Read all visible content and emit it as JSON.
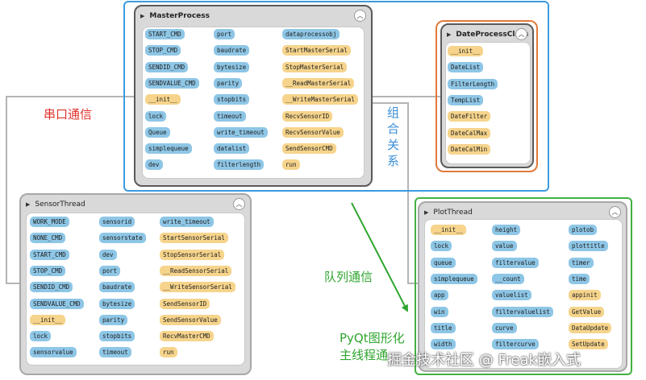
{
  "colors": {
    "attribute_chip": "#8ec6e6",
    "method_chip": "#f6d48c",
    "master_frame": "#3a9be0",
    "date_frame": "#e07a3a",
    "plot_frame": "#43b043",
    "serial_label": "#e0312b",
    "compose_label": "#3a8fd6",
    "queue_label": "#2fa52f",
    "connector": "#b5b5b5",
    "arrow": "#2fa52f"
  },
  "icons": {
    "collapse": "chevron-up-icon",
    "expand": "disclosure-triangle-icon"
  },
  "labels": {
    "serial_comm": "串口通信",
    "composition": "组合关系",
    "queue_comm": "队列通信",
    "pyqt_line1": "PyQt图形化",
    "pyqt_line2": "主线程通",
    "watermark": "掘金技术社区 @ Freak嵌入式"
  },
  "classes": {
    "master": {
      "title": "MasterProcess",
      "columns": [
        [
          {
            "t": "START_CMD",
            "k": "attr"
          },
          {
            "t": "STOP_CMD",
            "k": "attr"
          },
          {
            "t": "SENDID_CMD",
            "k": "attr"
          },
          {
            "t": "SENDVALUE_CMD",
            "k": "attr"
          },
          {
            "t": "__init__",
            "k": "meth"
          },
          {
            "t": "lock",
            "k": "attr"
          },
          {
            "t": "Queue",
            "k": "attr"
          },
          {
            "t": "simplequeue",
            "k": "attr"
          },
          {
            "t": "dev",
            "k": "attr"
          }
        ],
        [
          {
            "t": "port",
            "k": "attr"
          },
          {
            "t": "baudrate",
            "k": "attr"
          },
          {
            "t": "bytesize",
            "k": "attr"
          },
          {
            "t": "parity",
            "k": "attr"
          },
          {
            "t": "stopbits",
            "k": "attr"
          },
          {
            "t": "timeout",
            "k": "attr"
          },
          {
            "t": "write_timeout",
            "k": "attr"
          },
          {
            "t": "datalist",
            "k": "attr"
          },
          {
            "t": "filterlength",
            "k": "attr"
          }
        ],
        [
          {
            "t": "dataprocessobj",
            "k": "attr"
          },
          {
            "t": "StartMasterSerial",
            "k": "meth"
          },
          {
            "t": "StopMasterSerial",
            "k": "meth"
          },
          {
            "t": "__ReadMasterSerial",
            "k": "meth"
          },
          {
            "t": "__WriteMasterSerial",
            "k": "meth"
          },
          {
            "t": "RecvSensorID",
            "k": "meth"
          },
          {
            "t": "RecvSensorValue",
            "k": "meth"
          },
          {
            "t": "SendSensorCMD",
            "k": "meth"
          },
          {
            "t": "run",
            "k": "meth"
          }
        ]
      ]
    },
    "date": {
      "title": "DateProcessClass",
      "columns": [
        [
          {
            "t": "__init__",
            "k": "meth"
          },
          {
            "t": "DateList",
            "k": "attr"
          },
          {
            "t": "FilterLength",
            "k": "attr"
          },
          {
            "t": "TempList",
            "k": "attr"
          },
          {
            "t": "DateFilter",
            "k": "meth"
          },
          {
            "t": "DateCalMax",
            "k": "meth"
          },
          {
            "t": "DateCalMin",
            "k": "meth"
          }
        ]
      ]
    },
    "sensor": {
      "title": "SensorThread",
      "columns": [
        [
          {
            "t": "WORK_MODE",
            "k": "attr"
          },
          {
            "t": "NONE_CMD",
            "k": "attr"
          },
          {
            "t": "START_CMD",
            "k": "attr"
          },
          {
            "t": "STOP_CMD",
            "k": "attr"
          },
          {
            "t": "SENDID_CMD",
            "k": "attr"
          },
          {
            "t": "SENDVALUE_CMD",
            "k": "attr"
          },
          {
            "t": "__init__",
            "k": "meth"
          },
          {
            "t": "lock",
            "k": "attr"
          },
          {
            "t": "sensorvalue",
            "k": "attr"
          }
        ],
        [
          {
            "t": "sensorid",
            "k": "attr"
          },
          {
            "t": "sensorstate",
            "k": "attr"
          },
          {
            "t": "dev",
            "k": "attr"
          },
          {
            "t": "port",
            "k": "attr"
          },
          {
            "t": "baudrate",
            "k": "attr"
          },
          {
            "t": "bytesize",
            "k": "attr"
          },
          {
            "t": "parity",
            "k": "attr"
          },
          {
            "t": "stopbits",
            "k": "attr"
          },
          {
            "t": "timeout",
            "k": "attr"
          }
        ],
        [
          {
            "t": "write_timeout",
            "k": "attr"
          },
          {
            "t": "StartSensorSerial",
            "k": "meth"
          },
          {
            "t": "StopSensorSerial",
            "k": "meth"
          },
          {
            "t": "__ReadSensorSerial",
            "k": "meth"
          },
          {
            "t": "__WriteSensorSerial",
            "k": "meth"
          },
          {
            "t": "SendSensorID",
            "k": "meth"
          },
          {
            "t": "SendSensorValue",
            "k": "meth"
          },
          {
            "t": "RecvMasterCMD",
            "k": "meth"
          },
          {
            "t": "run",
            "k": "meth"
          }
        ]
      ]
    },
    "plot": {
      "title": "PlotThread",
      "columns": [
        [
          {
            "t": "__init__",
            "k": "meth"
          },
          {
            "t": "lock",
            "k": "attr"
          },
          {
            "t": "queue",
            "k": "attr"
          },
          {
            "t": "simplequeue",
            "k": "attr"
          },
          {
            "t": "app",
            "k": "attr"
          },
          {
            "t": "win",
            "k": "attr"
          },
          {
            "t": "title",
            "k": "attr"
          },
          {
            "t": "width",
            "k": "attr"
          }
        ],
        [
          {
            "t": "height",
            "k": "attr"
          },
          {
            "t": "value",
            "k": "attr"
          },
          {
            "t": "filtervalue",
            "k": "attr"
          },
          {
            "t": "__count",
            "k": "attr"
          },
          {
            "t": "valuelist",
            "k": "attr"
          },
          {
            "t": "filtervaluelist",
            "k": "attr"
          },
          {
            "t": "curve",
            "k": "attr"
          },
          {
            "t": "filtercurve",
            "k": "attr"
          }
        ],
        [
          {
            "t": "plotob",
            "k": "attr"
          },
          {
            "t": "plottitle",
            "k": "attr"
          },
          {
            "t": "timer",
            "k": "attr"
          },
          {
            "t": "time",
            "k": "attr"
          },
          {
            "t": "appinit",
            "k": "meth"
          },
          {
            "t": "GetValue",
            "k": "meth"
          },
          {
            "t": "DataUpdate",
            "k": "meth"
          },
          {
            "t": "SetUpdate",
            "k": "meth"
          }
        ]
      ]
    }
  }
}
